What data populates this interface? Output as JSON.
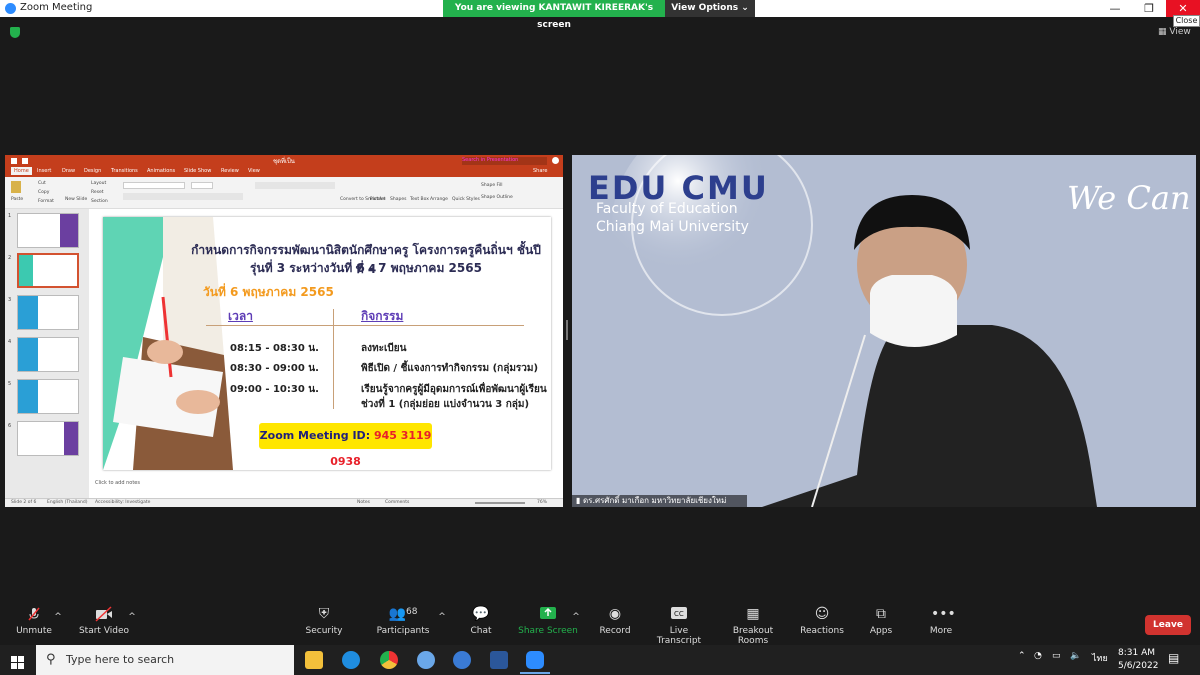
{
  "titlebar": {
    "title": "Zoom Meeting",
    "viewing_banner": "You are viewing KANTAWIT KIREERAK's screen",
    "view_options": "View Options",
    "close_tip": "Close",
    "view_label": "View"
  },
  "ppt": {
    "filename": "ชุดที่เป็น",
    "search_placeholder": "Search in Presentation",
    "share": "Share",
    "tabs": [
      "Home",
      "Insert",
      "Draw",
      "Design",
      "Transitions",
      "Animations",
      "Slide Show",
      "Review",
      "View"
    ],
    "ribbon": [
      "Paste",
      "Cut",
      "Copy",
      "Format",
      "New Slide",
      "Layout",
      "Reset",
      "Section",
      "Picture",
      "Shapes",
      "Text Box",
      "Arrange",
      "Quick Styles",
      "Shape Fill",
      "Shape Outline",
      "Convert to SmartArt"
    ],
    "thumb_numbers": [
      "1",
      "2",
      "3",
      "4",
      "5",
      "6"
    ],
    "notes": "Click to add notes",
    "status_left": "Slide 2 of 6",
    "status_lang": "English (Thailand)",
    "status_access": "Accessibility: Investigate",
    "status_notes": "Notes",
    "status_comments": "Comments",
    "zoom_pct": "76%"
  },
  "slide": {
    "title_line1": "กำหนดการกิจกรรมพัฒนานิสิตนักศึกษาครู โครงการครูคืนถิ่นฯ ชั้นปีที่ 4",
    "title_line2": "รุ่นที่ 3 ระหว่างวันที่ 6 - 7 พฤษภาคม 2565",
    "date": "วันที่ 6 พฤษภาคม 2565",
    "col_time": "เวลา",
    "col_activity": "กิจกรรม",
    "rows": [
      {
        "time": "08:15 - 08:30 น.",
        "activity": "ลงทะเบียน",
        "activity2": ""
      },
      {
        "time": "08:30 - 09:00 น.",
        "activity": "พิธีเปิด / ชี้แจงการทำกิจกรรม (กลุ่มรวม)",
        "activity2": ""
      },
      {
        "time": "09:00 - 10:30 น.",
        "activity": "เรียนรู้จากครูผู้มีอุดมการณ์เพื่อพัฒนาผู้เรียน",
        "activity2": "ช่วงที่ 1 (กลุ่มย่อย แบ่งจำนวน 3 กลุ่ม)"
      }
    ],
    "zoom_label": "Zoom Meeting ID:",
    "zoom_id": "945 3119 0938"
  },
  "video": {
    "edu": "EDU CMU",
    "faculty": "Faculty of Education",
    "university": "Chiang Mai University",
    "wecan": "We Can",
    "participant_name": "ดร.ศรศักดิ์ มาเกือก มหาวิทยาลัยเชียงใหม่"
  },
  "controls": {
    "unmute": "Unmute",
    "start_video": "Start Video",
    "security": "Security",
    "participants": "Participants",
    "participants_count": "68",
    "chat": "Chat",
    "share_screen": "Share Screen",
    "record": "Record",
    "live_transcript": "Live Transcript",
    "breakout_rooms": "Breakout Rooms",
    "reactions": "Reactions",
    "apps": "Apps",
    "more": "More",
    "leave": "Leave",
    "accent_green": "#23b14d",
    "leave_red": "#d1332f"
  },
  "taskbar": {
    "search_placeholder": "Type here to search",
    "time": "8:31 AM",
    "date": "5/6/2022",
    "lang": "ไทย"
  }
}
